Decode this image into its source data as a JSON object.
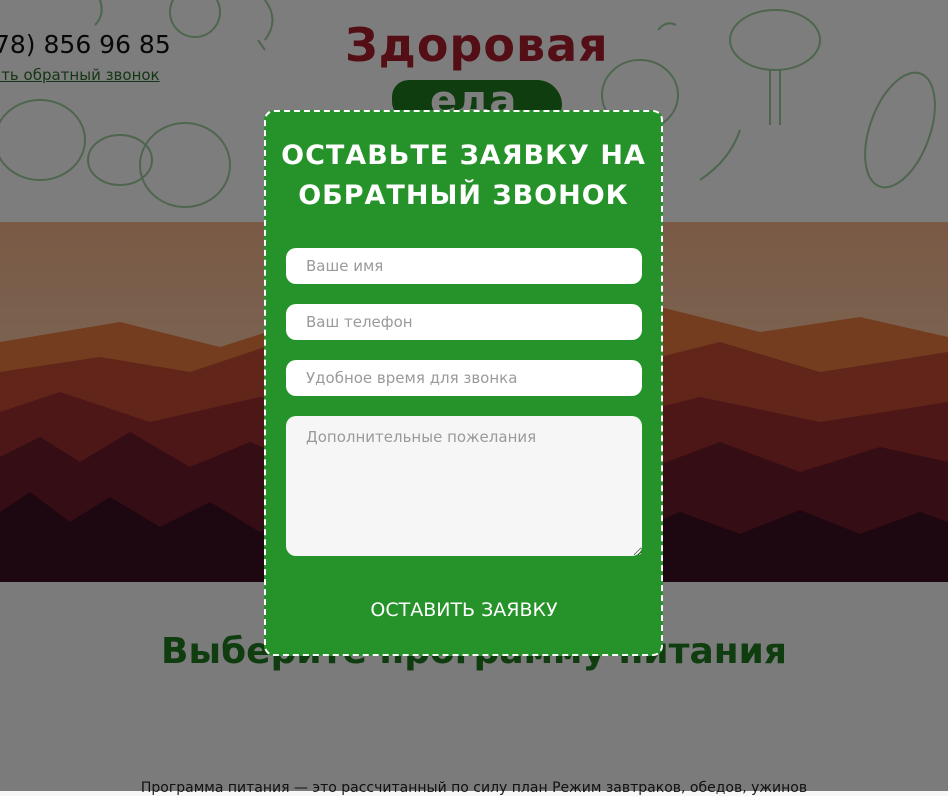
{
  "header": {
    "phone": "78) 856 96 85",
    "callback_link": "ать обратный звонок",
    "logo": {
      "top": "Здоровая",
      "bottom": "еда"
    }
  },
  "section": {
    "title": "Выберите программу питания",
    "text": "Программа питания — это рассчитанный по силу план Режим завтраков, обедов, ужинов"
  },
  "modal": {
    "title": "Оставьте заявку на обратный звонок",
    "fields": {
      "name_placeholder": "Ваше имя",
      "phone_placeholder": "Ваш телефон",
      "time_placeholder": "Удобное время для звонка",
      "wishes_placeholder": "Дополнительные пожелания"
    },
    "submit_label": "Оставить заявку"
  },
  "colors": {
    "modal_bg": "#25932a",
    "logo_red": "#a81c2a",
    "brand_green": "#1f7a1f"
  },
  "icons": [
    "vegetable-doodles",
    "mountain-landscape"
  ]
}
